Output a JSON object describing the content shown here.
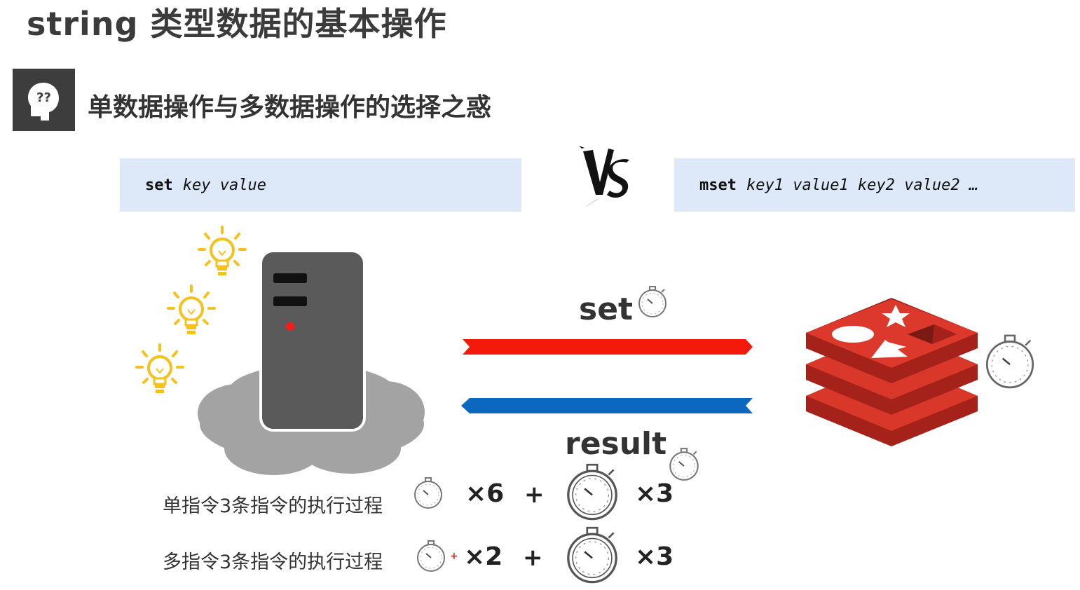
{
  "title": "string 类型数据的基本操作",
  "subtitle": "单数据操作与多数据操作的选择之惑",
  "commands": {
    "left": {
      "keyword": "set",
      "args": "key value"
    },
    "right": {
      "keyword": "mset",
      "args": "key1 value1 key2 value2 …"
    }
  },
  "diagram": {
    "send_label": "set",
    "return_label": "result"
  },
  "rows": [
    {
      "label": "单指令3条指令的执行过程",
      "small_mult": "×6",
      "plus": "+",
      "big_mult": "×3"
    },
    {
      "label": "多指令3条指令的执行过程",
      "small_mult": "×2",
      "plus": "+",
      "big_mult": "×3"
    }
  ],
  "colors": {
    "send_arrow": "#f41a0b",
    "return_arrow": "#0a68c0",
    "command_box": "#dde8f8",
    "redis": "#d8372a",
    "bulb": "#f5c21b",
    "server": "#555555"
  },
  "icons": [
    "question-head-icon",
    "vs-icon",
    "lightbulb-icon",
    "server-icon",
    "cloud-icon",
    "stopwatch-icon",
    "redis-logo-icon"
  ]
}
